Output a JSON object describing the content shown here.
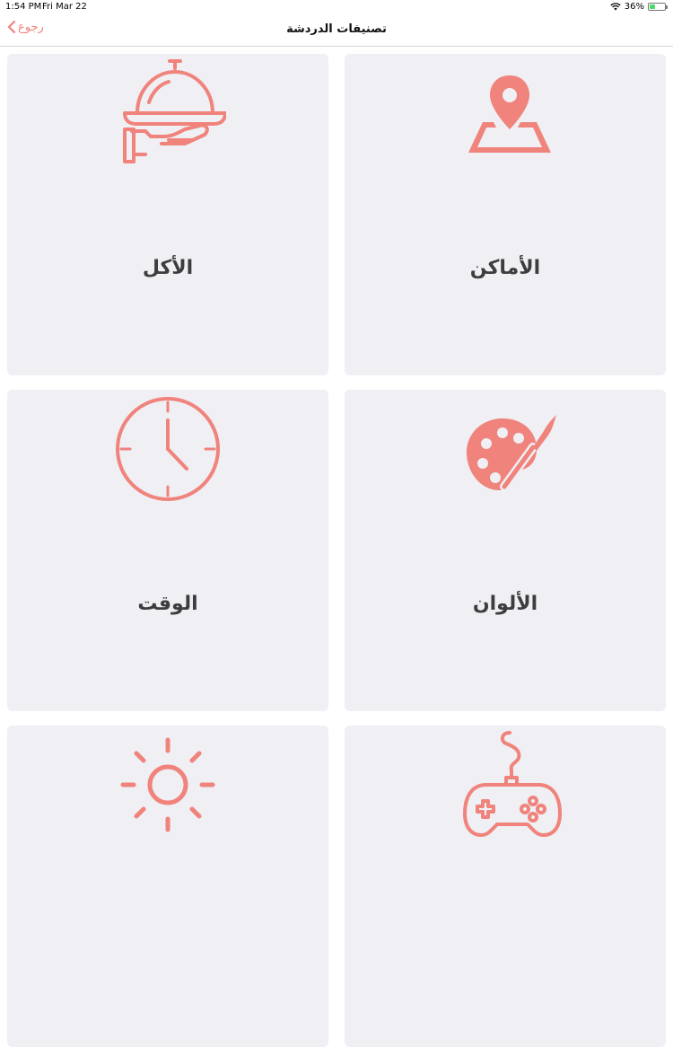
{
  "status": {
    "time": "1:54 PM",
    "date": "Fri Mar 22",
    "battery": "36%",
    "battery_level": 0.36
  },
  "nav": {
    "back_label": "رجوع",
    "title": "تصنيفات الدردشة"
  },
  "categories": [
    {
      "label": "الأماكن",
      "icon": "map-pin-icon"
    },
    {
      "label": "الأكل",
      "icon": "food-serving-icon"
    },
    {
      "label": "الألوان",
      "icon": "palette-icon"
    },
    {
      "label": "الوقت",
      "icon": "clock-icon"
    },
    {
      "label": "",
      "icon": "gamepad-icon"
    },
    {
      "label": "",
      "icon": "sun-icon"
    }
  ],
  "colors": {
    "accent": "#f0837c",
    "card_bg": "#efeff4",
    "label": "#3d3d3f"
  }
}
